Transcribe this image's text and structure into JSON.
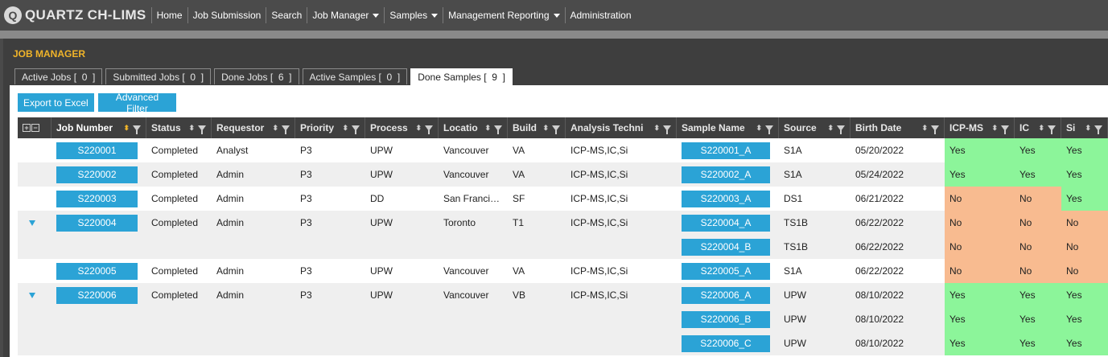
{
  "app": {
    "logo_mark": "Q",
    "logo_text": "QUARTZ CH-LIMS"
  },
  "nav": [
    {
      "label": "Home",
      "dropdown": false
    },
    {
      "label": "Job Submission",
      "dropdown": false
    },
    {
      "label": "Search",
      "dropdown": false
    },
    {
      "label": "Job Manager",
      "dropdown": true
    },
    {
      "label": "Samples",
      "dropdown": true
    },
    {
      "label": "Management Reporting",
      "dropdown": true
    },
    {
      "label": "Administration",
      "dropdown": false
    }
  ],
  "panel": {
    "title": "JOB MANAGER"
  },
  "tabs": [
    {
      "label": "Active Jobs [  0  ]",
      "active": false
    },
    {
      "label": "Submitted Jobs [  0  ]",
      "active": false
    },
    {
      "label": "Done Jobs [  6  ]",
      "active": false
    },
    {
      "label": "Active Samples [  0  ]",
      "active": false
    },
    {
      "label": "Done Samples [  9  ]",
      "active": true
    }
  ],
  "toolbar": {
    "export_label": "Export to Excel",
    "filter_label": "Advanced Filter"
  },
  "columns": [
    {
      "key": "job",
      "label": "Job Number",
      "sorted": true
    },
    {
      "key": "status",
      "label": "Status"
    },
    {
      "key": "requestor",
      "label": "Requestor"
    },
    {
      "key": "priority",
      "label": "Priority"
    },
    {
      "key": "process",
      "label": "Process"
    },
    {
      "key": "location",
      "label": "Locatio"
    },
    {
      "key": "build",
      "label": "Build"
    },
    {
      "key": "technique",
      "label": "Analysis Techni"
    },
    {
      "key": "sample",
      "label": "Sample Name"
    },
    {
      "key": "source",
      "label": "Source"
    },
    {
      "key": "birth",
      "label": "Birth Date"
    },
    {
      "key": "icpms",
      "label": "ICP-MS"
    },
    {
      "key": "ic",
      "label": "IC"
    },
    {
      "key": "si",
      "label": "Si"
    }
  ],
  "rows": [
    {
      "expand": false,
      "job": "S220001",
      "status": "Completed",
      "requestor": "Analyst",
      "priority": "P3",
      "process": "UPW",
      "location": "Vancouver",
      "build": "VA",
      "technique": "ICP-MS,IC,Si",
      "sample": "S220001_A",
      "source": "S1A",
      "birth": "05/20/2022",
      "icpms": "Yes",
      "ic": "Yes",
      "si": "Yes"
    },
    {
      "expand": false,
      "job": "S220002",
      "status": "Completed",
      "requestor": "Admin",
      "priority": "P3",
      "process": "UPW",
      "location": "Vancouver",
      "build": "VA",
      "technique": "ICP-MS,IC,Si",
      "sample": "S220002_A",
      "source": "S1A",
      "birth": "05/24/2022",
      "icpms": "Yes",
      "ic": "Yes",
      "si": "Yes"
    },
    {
      "expand": false,
      "job": "S220003",
      "status": "Completed",
      "requestor": "Admin",
      "priority": "P3",
      "process": "DD",
      "location": "San Franci…",
      "build": "SF",
      "technique": "ICP-MS,IC,Si",
      "sample": "S220003_A",
      "source": "DS1",
      "birth": "06/21/2022",
      "icpms": "No",
      "ic": "No",
      "si": "Yes"
    },
    {
      "expand": true,
      "job": "S220004",
      "status": "Completed",
      "requestor": "Admin",
      "priority": "P3",
      "process": "UPW",
      "location": "Toronto",
      "build": "T1",
      "technique": "ICP-MS,IC,Si",
      "sample": "S220004_A",
      "source": "TS1B",
      "birth": "06/22/2022",
      "icpms": "No",
      "ic": "No",
      "si": "No"
    },
    {
      "expand": false,
      "job": "",
      "status": "",
      "requestor": "",
      "priority": "",
      "process": "",
      "location": "",
      "build": "",
      "technique": "",
      "sample": "S220004_B",
      "source": "TS1B",
      "birth": "06/22/2022",
      "icpms": "No",
      "ic": "No",
      "si": "No"
    },
    {
      "expand": false,
      "job": "S220005",
      "status": "Completed",
      "requestor": "Admin",
      "priority": "P3",
      "process": "UPW",
      "location": "Vancouver",
      "build": "VA",
      "technique": "ICP-MS,IC,Si",
      "sample": "S220005_A",
      "source": "S1A",
      "birth": "06/22/2022",
      "icpms": "No",
      "ic": "No",
      "si": "No"
    },
    {
      "expand": true,
      "job": "S220006",
      "status": "Completed",
      "requestor": "Admin",
      "priority": "P3",
      "process": "UPW",
      "location": "Vancouver",
      "build": "VB",
      "technique": "ICP-MS,IC,Si",
      "sample": "S220006_A",
      "source": "UPW",
      "birth": "08/10/2022",
      "icpms": "Yes",
      "ic": "Yes",
      "si": "Yes"
    },
    {
      "expand": false,
      "job": "",
      "status": "",
      "requestor": "",
      "priority": "",
      "process": "",
      "location": "",
      "build": "",
      "technique": "",
      "sample": "S220006_B",
      "source": "UPW",
      "birth": "08/10/2022",
      "icpms": "Yes",
      "ic": "Yes",
      "si": "Yes"
    },
    {
      "expand": false,
      "job": "",
      "status": "",
      "requestor": "",
      "priority": "",
      "process": "",
      "location": "",
      "build": "",
      "technique": "",
      "sample": "S220006_C",
      "source": "UPW",
      "birth": "08/10/2022",
      "icpms": "Yes",
      "ic": "Yes",
      "si": "Yes"
    }
  ],
  "row_shading": [
    false,
    true,
    false,
    true,
    true,
    false,
    true,
    true,
    true
  ],
  "colors": {
    "accent": "#2ba3d6",
    "yes": "#8cf59a",
    "no": "#f8bb90",
    "title": "#f0b429"
  }
}
